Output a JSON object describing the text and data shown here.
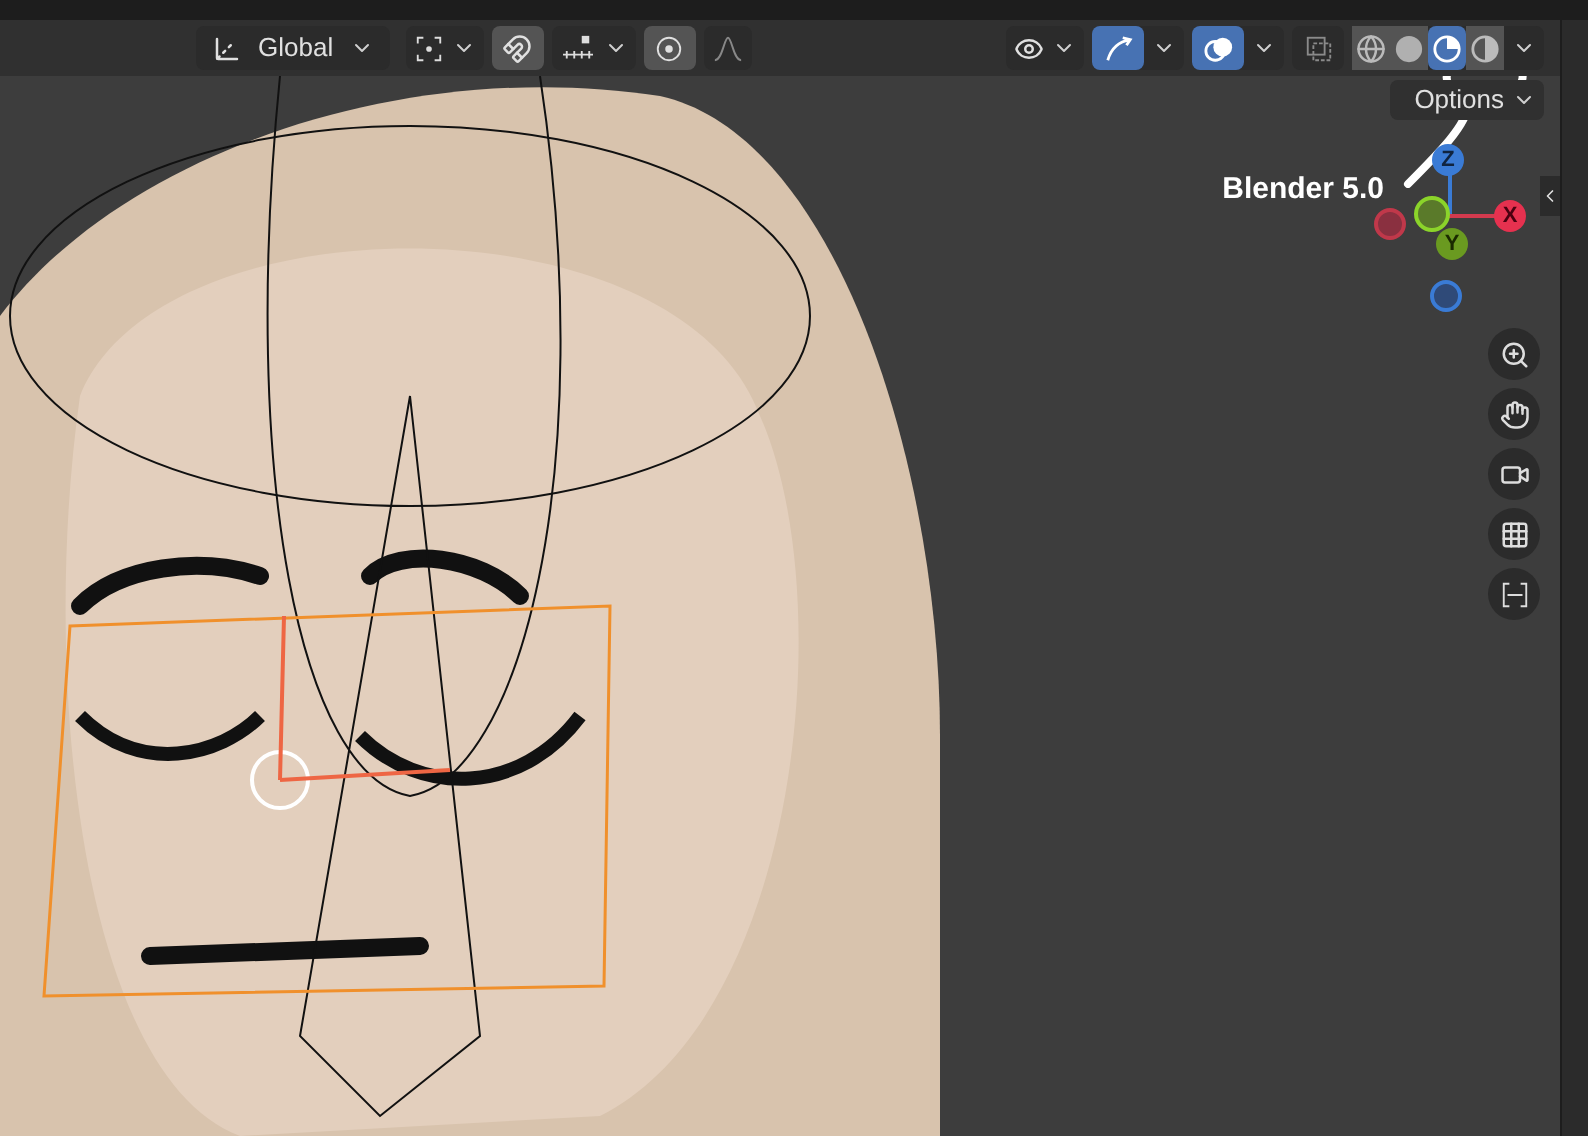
{
  "header": {
    "transform_orientation": "Global",
    "snapping": {
      "on": true
    },
    "proportional_editing": {
      "on": true
    },
    "visibility": {
      "on": false
    },
    "gizmos": {
      "on": true
    },
    "overlays": {
      "on": true
    },
    "xray": {
      "on": false
    },
    "shading_modes": [
      {
        "kind": "wireframe",
        "selected": false
      },
      {
        "kind": "solid",
        "selected": false
      },
      {
        "kind": "material",
        "selected": true
      },
      {
        "kind": "rendered",
        "selected": false
      }
    ]
  },
  "options_button": "Options",
  "annotation": "Blender 5.0",
  "axis_gizmo": [
    {
      "label": "Z"
    },
    {
      "label": "X"
    },
    {
      "label": "Y"
    }
  ]
}
